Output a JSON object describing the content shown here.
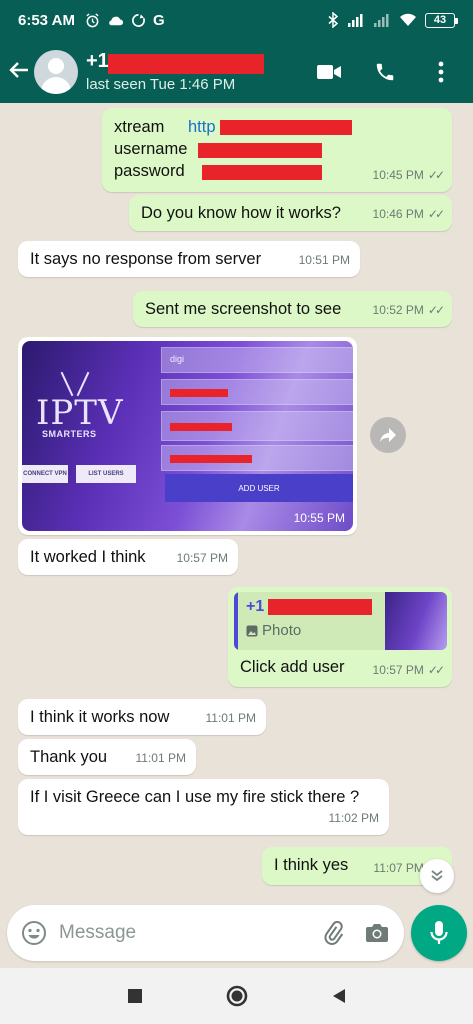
{
  "status_bar": {
    "time": "6:53 AM",
    "battery": "43"
  },
  "header": {
    "contact_name": "+1",
    "contact_status": "last seen Tue 1:46 PM"
  },
  "messages": [
    {
      "direction": "out",
      "lines": [
        {
          "label": "xtream",
          "value": "http"
        },
        {
          "label": "username",
          "value": ""
        },
        {
          "label": "password",
          "value": ""
        }
      ],
      "time": "10:45 PM"
    },
    {
      "direction": "out",
      "text": "Do you know how it works?",
      "time": "10:46 PM"
    },
    {
      "direction": "in",
      "text": "It says no response from server",
      "time": "10:51 PM"
    },
    {
      "direction": "out",
      "text": "Sent me screenshot to see",
      "time": "10:52 PM"
    },
    {
      "direction": "in",
      "type": "photo",
      "time": "10:55 PM",
      "photo": {
        "app_name": "IPTV",
        "app_subtitle": "SMARTERS",
        "field_1": "digi",
        "button_connect_vpn": "CONNECT VPN",
        "button_list_users": "LIST USERS",
        "button_add_user": "ADD USER"
      }
    },
    {
      "direction": "in",
      "text": "It worked I think",
      "time": "10:57 PM"
    },
    {
      "direction": "out",
      "text": "Click add user",
      "time": "10:57 PM",
      "quote": {
        "name": "+1",
        "type": "Photo"
      }
    },
    {
      "direction": "in",
      "text": "I think it works now",
      "time": "11:01 PM"
    },
    {
      "direction": "in",
      "text": "Thank you",
      "time": "11:01 PM"
    },
    {
      "direction": "in",
      "text": "If I visit Greece can I use my fire stick there ?",
      "time": "11:02 PM"
    },
    {
      "direction": "out",
      "text": "I think yes",
      "time": "11:07 PM"
    }
  ],
  "composer": {
    "placeholder": "Message"
  },
  "colors": {
    "header": "#075e54",
    "outgoing_bubble": "#dcf8c6",
    "incoming_bubble": "#ffffff",
    "chat_background": "#e9e2d9",
    "mic_button": "#00a884",
    "redaction": "#e8242a"
  }
}
